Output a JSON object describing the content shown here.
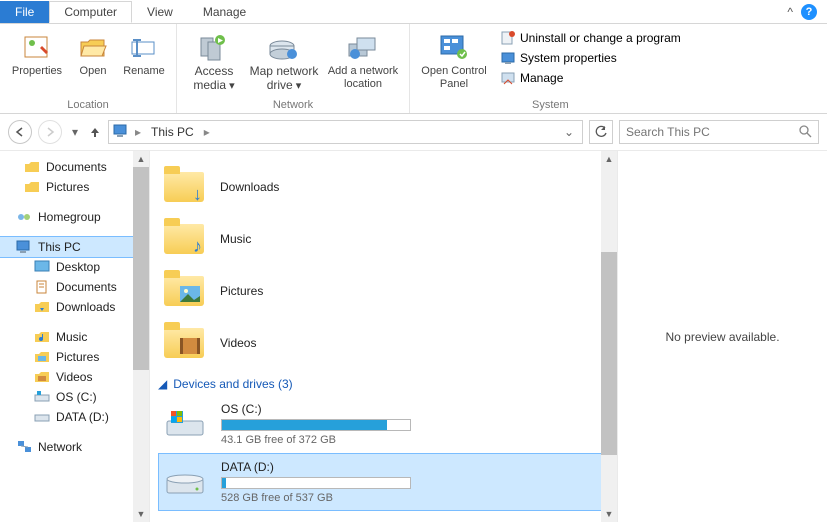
{
  "tabs": {
    "file": "File",
    "computer": "Computer",
    "view": "View",
    "manage": "Manage"
  },
  "ribbon": {
    "location": {
      "label": "Location",
      "properties": "Properties",
      "open": "Open",
      "rename": "Rename"
    },
    "network": {
      "label": "Network",
      "access_media": "Access media",
      "map_drive": "Map network drive",
      "add_location": "Add a network location"
    },
    "system": {
      "label": "System",
      "open_cp": "Open Control Panel",
      "uninstall": "Uninstall or change a program",
      "sys_props": "System properties",
      "manage": "Manage"
    }
  },
  "addr": {
    "crumb": "This PC",
    "search_placeholder": "Search This PC"
  },
  "nav": {
    "documents": "Documents",
    "pictures": "Pictures",
    "homegroup": "Homegroup",
    "this_pc": "This PC",
    "desktop": "Desktop",
    "documents2": "Documents",
    "downloads": "Downloads",
    "music": "Music",
    "pictures2": "Pictures",
    "videos": "Videos",
    "os_c": "OS (C:)",
    "data_d": "DATA (D:)",
    "network": "Network"
  },
  "content": {
    "folders": {
      "downloads": "Downloads",
      "music": "Music",
      "pictures": "Pictures",
      "videos": "Videos"
    },
    "section": "Devices and drives (3)",
    "drives": [
      {
        "name": "OS (C:)",
        "status": "43.1 GB free of 372 GB",
        "fill_pct": 88
      },
      {
        "name": "DATA (D:)",
        "status": "528 GB free of 537 GB",
        "fill_pct": 2
      }
    ]
  },
  "preview": {
    "msg": "No preview available."
  }
}
